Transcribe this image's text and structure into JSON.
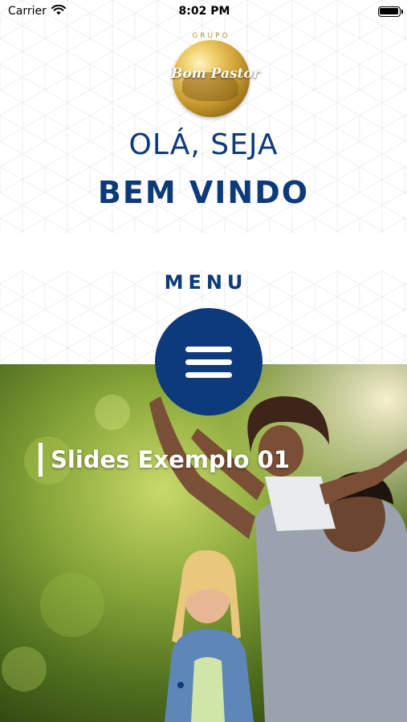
{
  "status_bar": {
    "carrier": "Carrier",
    "time": "8:02 PM",
    "wifi_icon": "wifi-icon",
    "battery_icon": "battery-icon",
    "battery_level": 1.0
  },
  "logo": {
    "group_text": "GRUPO",
    "name": "Bom Pastor",
    "icon": "globe-logo"
  },
  "greeting": {
    "line1": "OLÁ, SEJA",
    "line2": "BEM VINDO"
  },
  "menu": {
    "label": "MENU",
    "icon": "hamburger-menu-icon"
  },
  "slider": {
    "slide_title": "Slides Exemplo 01",
    "active_index": 0
  },
  "colors": {
    "brand_blue": "#0d3a7a",
    "gold": "#c99a2e"
  }
}
